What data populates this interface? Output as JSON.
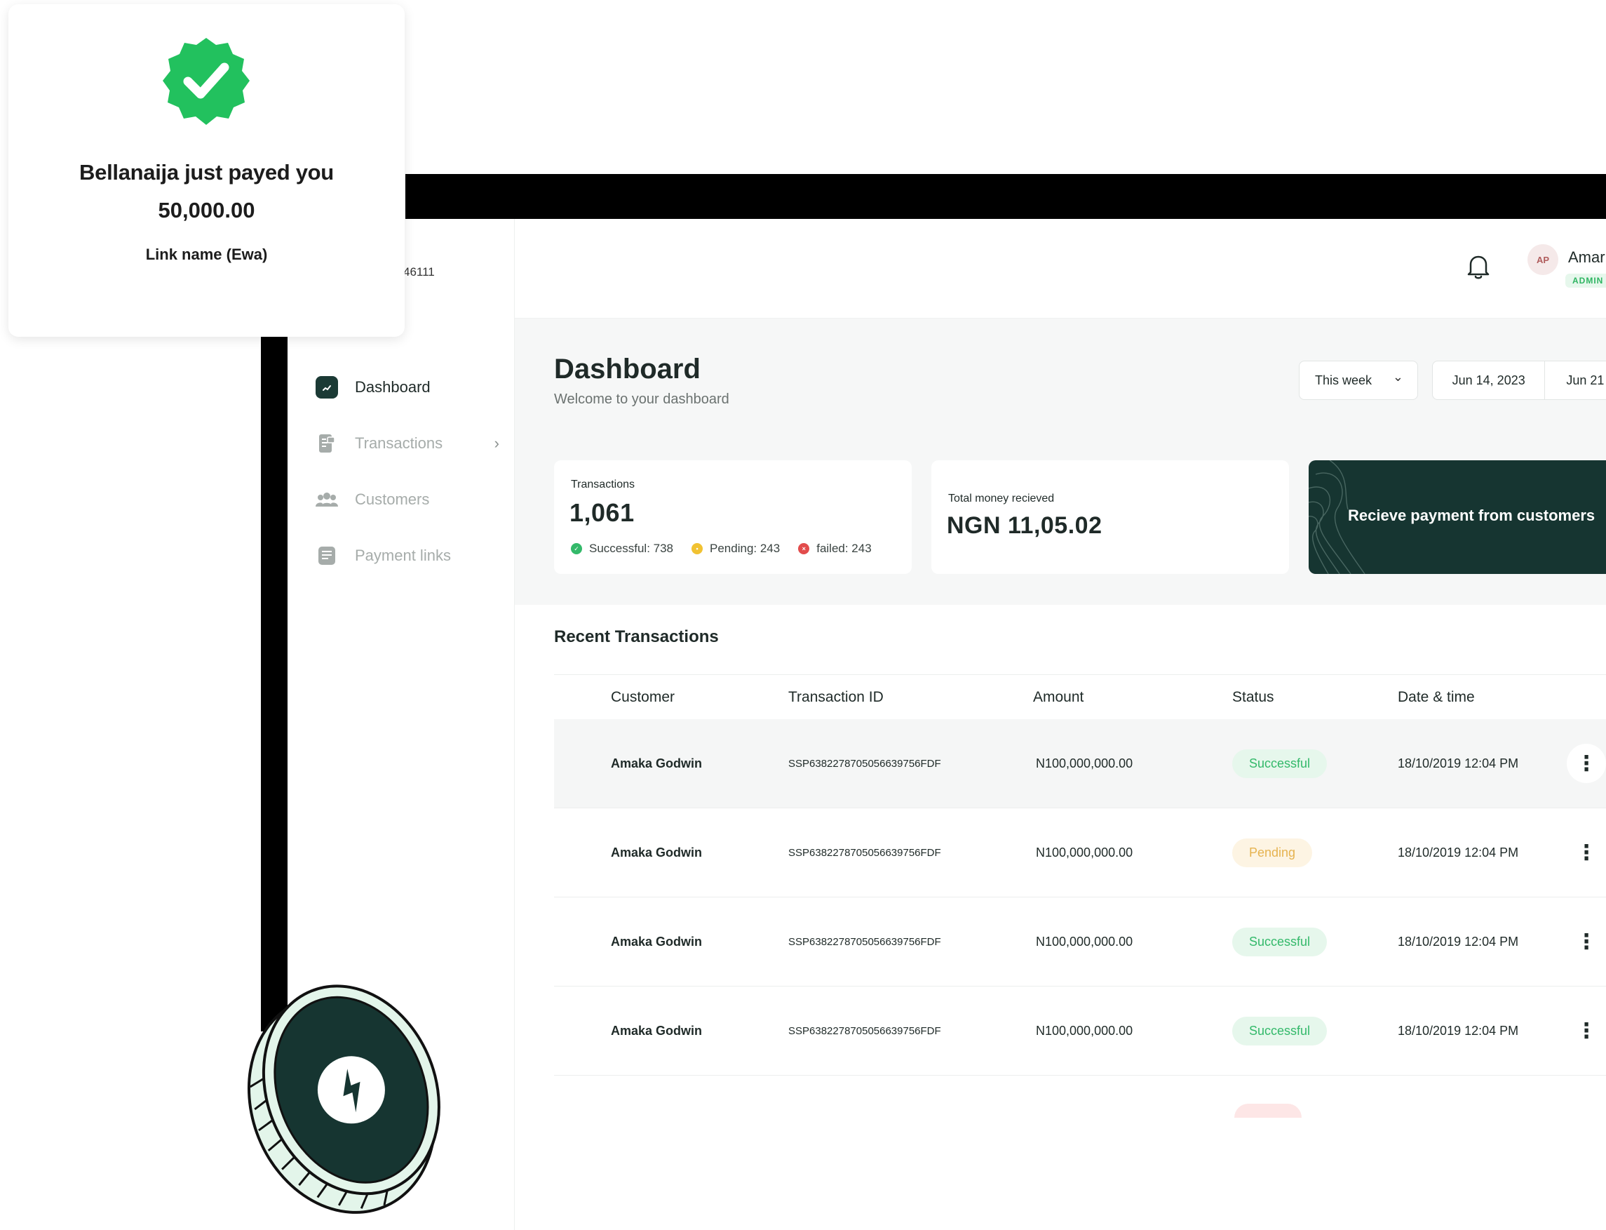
{
  "notification": {
    "title": "Bellanaija just payed you",
    "amount": "50,000.00",
    "link_name": "Link name (Ewa)"
  },
  "sidebar": {
    "account_suffix": "46111",
    "items": [
      {
        "label": "Dashboard",
        "icon": "dashboard-icon",
        "active": true
      },
      {
        "label": "Transactions",
        "icon": "receipt-icon",
        "has_chevron": true
      },
      {
        "label": "Customers",
        "icon": "users-icon"
      },
      {
        "label": "Payment links",
        "icon": "document-icon"
      }
    ]
  },
  "header": {
    "avatar_initials": "AP",
    "user_name": "Amar",
    "role": "ADMIN"
  },
  "dashboard": {
    "title": "Dashboard",
    "subtitle": "Welcome to your dashboard",
    "period": "This week",
    "date_start": "Jun 14, 2023",
    "date_end": "Jun 21"
  },
  "cards": {
    "transactions": {
      "label": "Transactions",
      "value": "1,061",
      "successful": "Successful: 738",
      "pending": "Pending: 243",
      "failed": "failed: 243"
    },
    "money": {
      "label": "Total money recieved",
      "value": "NGN 11,05.02"
    },
    "cta": "Recieve payment  from customers"
  },
  "recent": {
    "title": "Recent Transactions",
    "columns": [
      "Customer",
      "Transaction ID",
      "Amount",
      "Status",
      "Date & time"
    ],
    "rows": [
      {
        "customer": "Amaka Godwin",
        "id": "SSP6382278705056639756FDF",
        "amount": "N100,000,000.00",
        "status": "Successful",
        "date": "18/10/2019 12:04 PM"
      },
      {
        "customer": "Amaka Godwin",
        "id": "SSP6382278705056639756FDF",
        "amount": "N100,000,000.00",
        "status": "Pending",
        "date": "18/10/2019 12:04 PM"
      },
      {
        "customer": "Amaka Godwin",
        "id": "SSP6382278705056639756FDF",
        "amount": "N100,000,000.00",
        "status": "Successful",
        "date": "18/10/2019 12:04 PM"
      },
      {
        "customer": "Amaka Godwin",
        "id": "SSP6382278705056639756FDF",
        "amount": "N100,000,000.00",
        "status": "Successful",
        "date": "18/10/2019 12:04 PM"
      }
    ]
  },
  "colors": {
    "brand": "#163531",
    "success": "#33b96a",
    "pending": "#e6b350",
    "failed": "#e24c4c"
  }
}
